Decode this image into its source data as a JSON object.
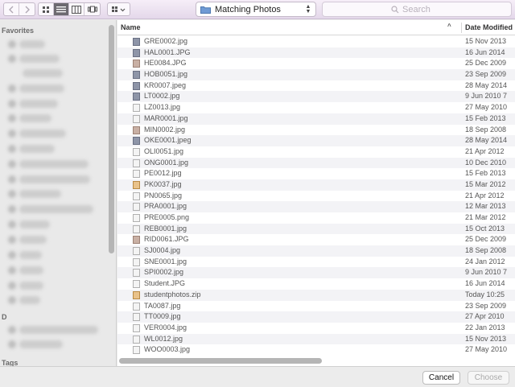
{
  "toolbar": {
    "back_icon": "chevron-left-icon",
    "forward_icon": "chevron-right-icon",
    "view_modes": [
      "icon-view",
      "list-view",
      "column-view",
      "cover-flow-view"
    ],
    "active_view": "list-view",
    "arrange_icon": "arrange-grid-icon",
    "location": {
      "label": "Matching Photos",
      "icon": "folder-icon"
    },
    "search": {
      "placeholder": "Search",
      "value": ""
    }
  },
  "sidebar": {
    "favorites_heading": "Favorites",
    "devices_heading": "D",
    "tags_heading": "Tags"
  },
  "filelist": {
    "columns": {
      "name": "Name",
      "date_modified": "Date Modified"
    },
    "sort_indicator": "^",
    "files": [
      {
        "name": "GRE0002.jpg",
        "date": "15 Nov 2013",
        "kind": "img-a"
      },
      {
        "name": "HAL0001.JPG",
        "date": "16 Jun 2014",
        "kind": "img-a"
      },
      {
        "name": "HE0084.JPG",
        "date": "25 Dec 2009",
        "kind": "img-b"
      },
      {
        "name": "HOB0051.jpg",
        "date": "23 Sep 2009",
        "kind": "img-a"
      },
      {
        "name": "KR0007.jpeg",
        "date": "28 May 2014",
        "kind": "img-a"
      },
      {
        "name": "LT0002.jpg",
        "date": "9 Jun 2010 7",
        "kind": "img-a"
      },
      {
        "name": "LZ0013.jpg",
        "date": "27 May 2010",
        "kind": "doc"
      },
      {
        "name": "MAR0001.jpg",
        "date": "15 Feb 2013",
        "kind": "doc"
      },
      {
        "name": "MIN0002.jpg",
        "date": "18 Sep 2008",
        "kind": "img-b"
      },
      {
        "name": "OKE0001.jpeg",
        "date": "28 May 2014",
        "kind": "img-a"
      },
      {
        "name": "OLI0051.jpg",
        "date": "21 Apr 2012",
        "kind": "doc"
      },
      {
        "name": "ONG0001.jpg",
        "date": "10 Dec 2010",
        "kind": "doc"
      },
      {
        "name": "PE0012.jpg",
        "date": "15 Feb 2013",
        "kind": "doc"
      },
      {
        "name": "PK0037.jpg",
        "date": "15 Mar 2012",
        "kind": "folder-zip"
      },
      {
        "name": "PN0065.jpg",
        "date": "21 Apr 2012",
        "kind": "doc"
      },
      {
        "name": "PRA0001.jpg",
        "date": "12 Mar 2013",
        "kind": "doc"
      },
      {
        "name": "PRE0005.png",
        "date": "21 Mar 2012",
        "kind": "doc"
      },
      {
        "name": "REB0001.jpg",
        "date": "15 Oct 2013",
        "kind": "doc"
      },
      {
        "name": "RID0061.JPG",
        "date": "25 Dec 2009",
        "kind": "img-b"
      },
      {
        "name": "SJ0004.jpg",
        "date": "18 Sep 2008",
        "kind": "doc"
      },
      {
        "name": "SNE0001.jpg",
        "date": "24 Jan 2012",
        "kind": "doc"
      },
      {
        "name": "SPI0002.jpg",
        "date": "9 Jun 2010 7",
        "kind": "doc"
      },
      {
        "name": "Student.JPG",
        "date": "16 Jun 2014",
        "kind": "doc"
      },
      {
        "name": "studentphotos.zip",
        "date": "Today 10:25",
        "kind": "folder-zip"
      },
      {
        "name": "TA0087.jpg",
        "date": "23 Sep 2009",
        "kind": "doc"
      },
      {
        "name": "TT0009.jpg",
        "date": "27 Apr 2010",
        "kind": "doc"
      },
      {
        "name": "VER0004.jpg",
        "date": "22 Jan 2013",
        "kind": "doc"
      },
      {
        "name": "WL0012.jpg",
        "date": "15 Nov 2013",
        "kind": "doc"
      },
      {
        "name": "WOO0003.jpg",
        "date": "27 May 2010",
        "kind": "doc"
      }
    ]
  },
  "buttons": {
    "cancel": "Cancel",
    "choose": "Choose"
  }
}
